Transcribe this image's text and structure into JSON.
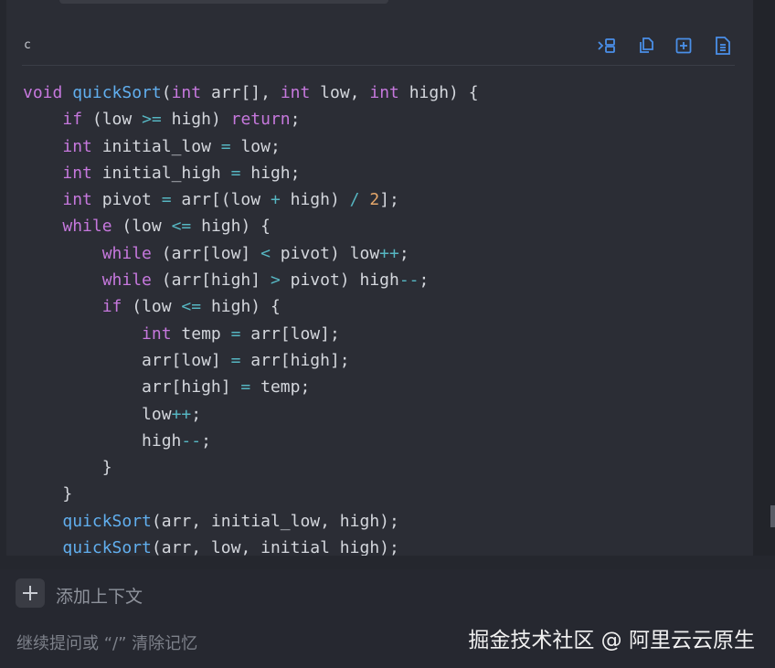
{
  "code_block": {
    "language": "c",
    "toolbar": {
      "insert_icon": "insert-code-icon",
      "copy_icon": "copy-icon",
      "new_file_icon": "new-file-icon",
      "apply_icon": "apply-file-icon"
    },
    "lines": [
      [
        [
          "kw",
          "void"
        ],
        [
          "t",
          " "
        ],
        [
          "fn",
          "quickSort"
        ],
        [
          "t",
          "("
        ],
        [
          "kw",
          "int"
        ],
        [
          "t",
          " arr[], "
        ],
        [
          "kw",
          "int"
        ],
        [
          "t",
          " low, "
        ],
        [
          "kw",
          "int"
        ],
        [
          "t",
          " high) {"
        ]
      ],
      [
        [
          "t",
          "    "
        ],
        [
          "kw",
          "if"
        ],
        [
          "t",
          " (low "
        ],
        [
          "op",
          ">="
        ],
        [
          "t",
          " high) "
        ],
        [
          "kw",
          "return"
        ],
        [
          "t",
          ";"
        ]
      ],
      [
        [
          "t",
          "    "
        ],
        [
          "kw",
          "int"
        ],
        [
          "t",
          " initial_low "
        ],
        [
          "op",
          "="
        ],
        [
          "t",
          " low;"
        ]
      ],
      [
        [
          "t",
          "    "
        ],
        [
          "kw",
          "int"
        ],
        [
          "t",
          " initial_high "
        ],
        [
          "op",
          "="
        ],
        [
          "t",
          " high;"
        ]
      ],
      [
        [
          "t",
          "    "
        ],
        [
          "kw",
          "int"
        ],
        [
          "t",
          " pivot "
        ],
        [
          "op",
          "="
        ],
        [
          "t",
          " arr[(low "
        ],
        [
          "op",
          "+"
        ],
        [
          "t",
          " high) "
        ],
        [
          "op",
          "/"
        ],
        [
          "t",
          " "
        ],
        [
          "num",
          "2"
        ],
        [
          "t",
          "];"
        ]
      ],
      [
        [
          "t",
          "    "
        ],
        [
          "kw",
          "while"
        ],
        [
          "t",
          " (low "
        ],
        [
          "op",
          "<="
        ],
        [
          "t",
          " high) {"
        ]
      ],
      [
        [
          "t",
          "        "
        ],
        [
          "kw",
          "while"
        ],
        [
          "t",
          " (arr[low] "
        ],
        [
          "op",
          "<"
        ],
        [
          "t",
          " pivot) low"
        ],
        [
          "op",
          "++"
        ],
        [
          "t",
          ";"
        ]
      ],
      [
        [
          "t",
          "        "
        ],
        [
          "kw",
          "while"
        ],
        [
          "t",
          " (arr[high] "
        ],
        [
          "op",
          ">"
        ],
        [
          "t",
          " pivot) high"
        ],
        [
          "op",
          "--"
        ],
        [
          "t",
          ";"
        ]
      ],
      [
        [
          "t",
          "        "
        ],
        [
          "kw",
          "if"
        ],
        [
          "t",
          " (low "
        ],
        [
          "op",
          "<="
        ],
        [
          "t",
          " high) {"
        ]
      ],
      [
        [
          "t",
          "            "
        ],
        [
          "kw",
          "int"
        ],
        [
          "t",
          " temp "
        ],
        [
          "op",
          "="
        ],
        [
          "t",
          " arr[low];"
        ]
      ],
      [
        [
          "t",
          "            arr[low] "
        ],
        [
          "op",
          "="
        ],
        [
          "t",
          " arr[high];"
        ]
      ],
      [
        [
          "t",
          "            arr[high] "
        ],
        [
          "op",
          "="
        ],
        [
          "t",
          " temp;"
        ]
      ],
      [
        [
          "t",
          "            low"
        ],
        [
          "op",
          "++"
        ],
        [
          "t",
          ";"
        ]
      ],
      [
        [
          "t",
          "            high"
        ],
        [
          "op",
          "--"
        ],
        [
          "t",
          ";"
        ]
      ],
      [
        [
          "t",
          "        }"
        ]
      ],
      [
        [
          "t",
          "    }"
        ]
      ],
      [
        [
          "t",
          "    "
        ],
        [
          "fn",
          "quickSort"
        ],
        [
          "t",
          "(arr, initial_low, high);"
        ]
      ],
      [
        [
          "t",
          "    "
        ],
        [
          "fn",
          "quickSort"
        ],
        [
          "t",
          "(arr, low, initial_high);"
        ]
      ]
    ]
  },
  "input": {
    "add_icon": "plus-icon",
    "add_context_label": "添加上下文",
    "placeholder": "继续提问或 “/” 清除记忆"
  },
  "watermark": "掘金技术社区 @ 阿里云云原生",
  "colors": {
    "background": "#25272e",
    "code_background": "#2b2d35",
    "keyword": "#c678dd",
    "function": "#61afef",
    "operator": "#56b6c2",
    "number": "#e5a76b",
    "text": "#d4d7dd",
    "toolbar_icon": "#4a8fe8"
  }
}
